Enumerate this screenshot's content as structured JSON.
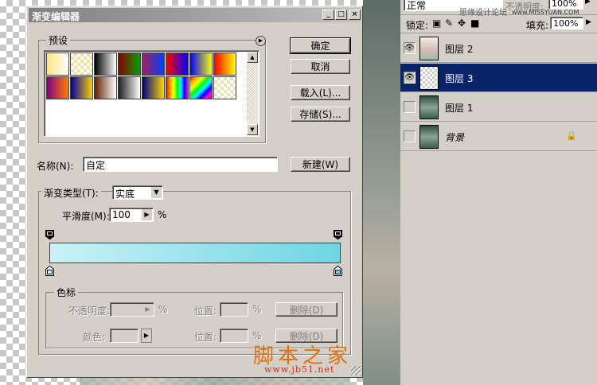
{
  "dialog": {
    "title": "渐变编辑器",
    "presets_label": "预设",
    "ok_button": "确定",
    "cancel_button": "取消",
    "load_button": "载入(L)...",
    "save_button": "存储(S)...",
    "name_label": "名称(N):",
    "name_value": "自定",
    "new_button": "新建(W)",
    "gradient_type_label": "渐变类型(T):",
    "gradient_type_value": "实底",
    "smoothness_label": "平滑度(M):",
    "smoothness_value": "100",
    "percent": "%",
    "stops_label": "色标",
    "opacity_label": "不透明度:",
    "color_label": "颜色:",
    "location_label": "位置:",
    "delete_button": "删除(D)",
    "gradient_colors": {
      "start": "#c9f2f7",
      "end": "#6fd5e3"
    },
    "presets": [
      [
        "#ffe680,#ffffff",
        "checker-yellow",
        "#000000,#ffffff",
        "#8b0000,#00a000",
        "#a02060,#0040ff",
        "#ff0000,#0000ff",
        "#0000ff,#ffff00",
        "#ff0000,#ffff00"
      ],
      [
        "#800080,#ff8000",
        "#0000a0,#ffd000",
        "#602000,#ffffff",
        "#202020,#ffffff",
        "#000080,#ffd700",
        "rainbow",
        "rainbow-diag",
        "checker-light"
      ]
    ]
  },
  "layers_panel": {
    "blend_mode": "正常",
    "opacity_label": "不透明度:",
    "opacity_value": "100%",
    "lock_label": "锁定:",
    "fill_label": "填充:",
    "fill_value": "100%",
    "site_text": "思缘设计论坛",
    "site_url": "www.MISSYUAN.COM",
    "layers": [
      {
        "name": "图层 2",
        "visible": true,
        "selected": false
      },
      {
        "name": "图层 3",
        "visible": true,
        "selected": true
      },
      {
        "name": "图层 1",
        "visible": false,
        "selected": false
      },
      {
        "name": "背景",
        "visible": false,
        "selected": false
      }
    ]
  },
  "watermark": {
    "text": "脚本之家",
    "url": "www.jb51.net"
  }
}
